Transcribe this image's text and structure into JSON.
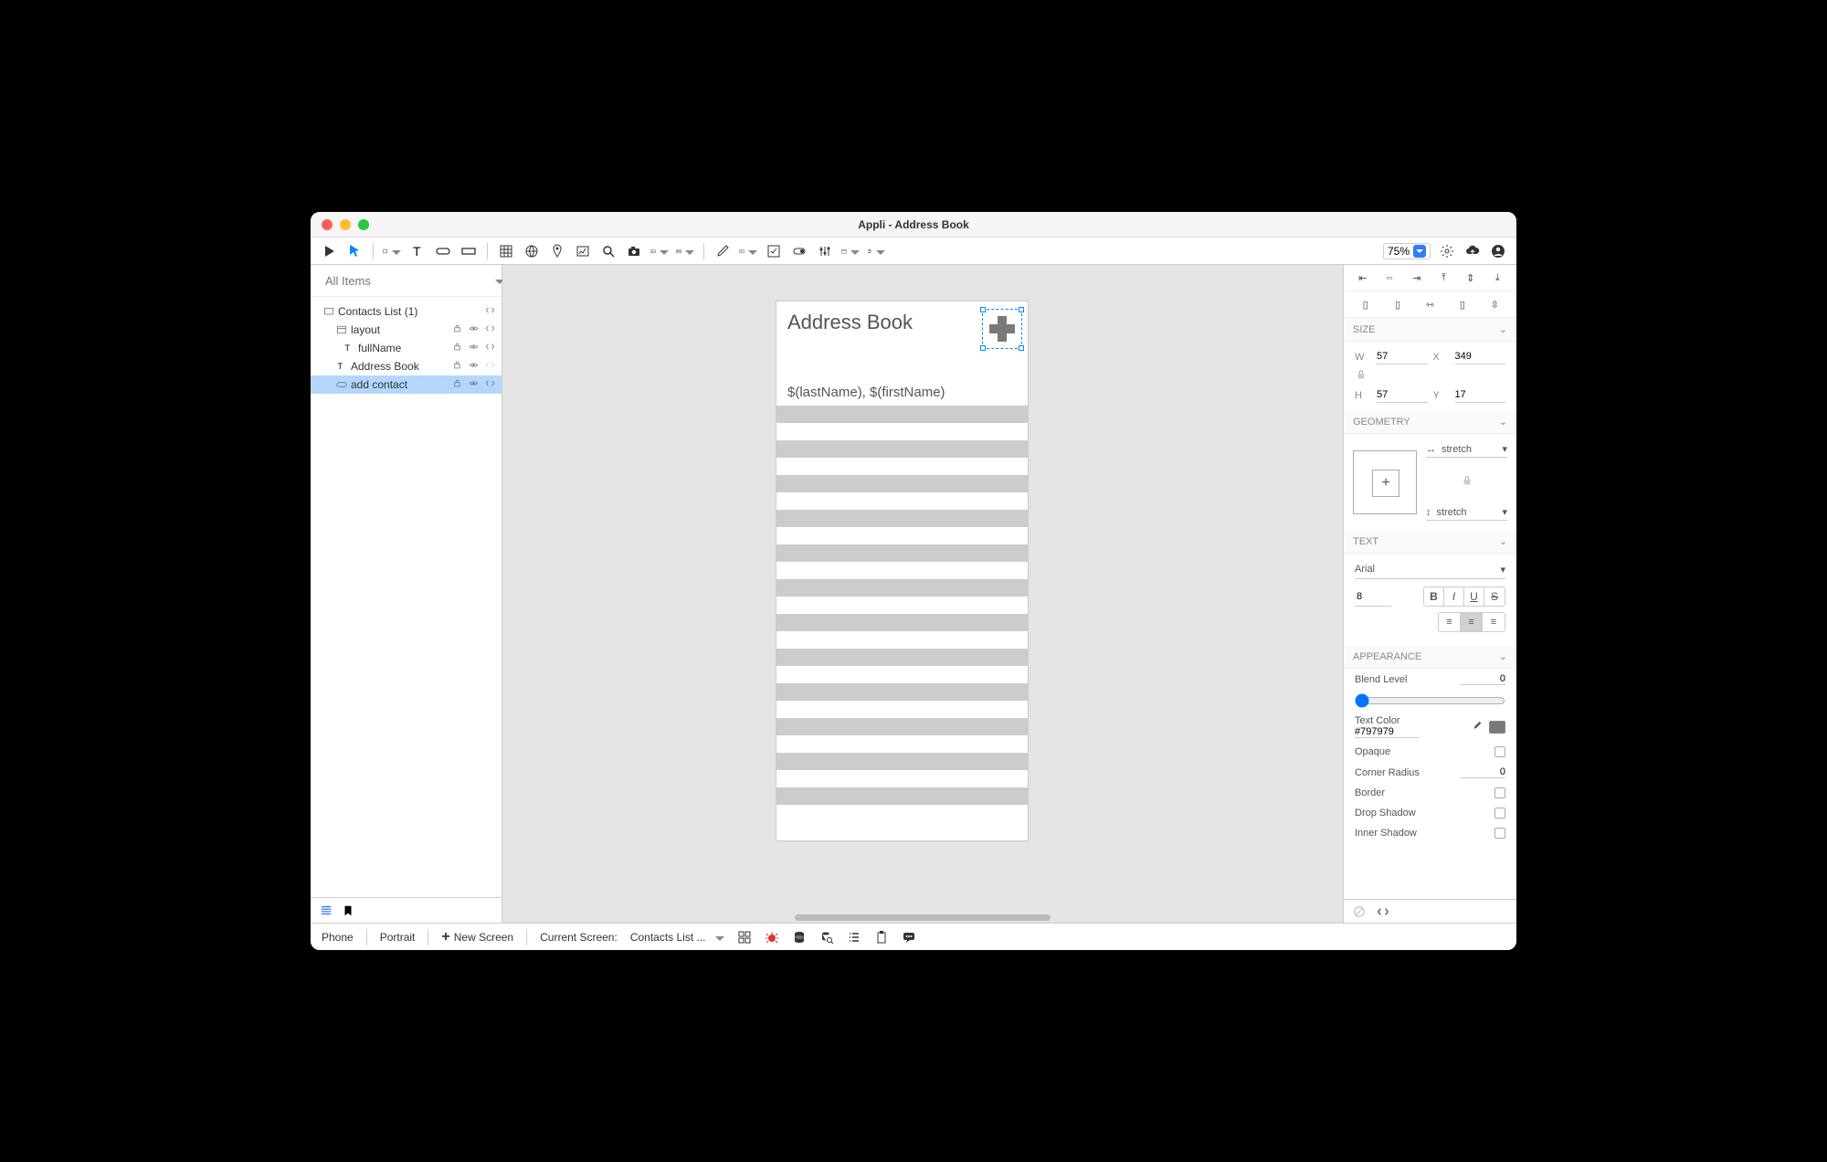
{
  "window": {
    "title": "Appli - Address Book"
  },
  "toolbar": {
    "zoom": "75%"
  },
  "leftPanel": {
    "searchPlaceholder": "All Items",
    "items": [
      {
        "label": "Contacts List (1)",
        "indent": 14,
        "icon": "screen",
        "right": [
          "code"
        ]
      },
      {
        "label": "layout",
        "indent": 28,
        "icon": "layout",
        "right": [
          "lock",
          "eye",
          "code"
        ]
      },
      {
        "label": "fullName",
        "indent": 36,
        "icon": "text",
        "right": [
          "lock",
          "eye",
          "code"
        ]
      },
      {
        "label": "Address Book",
        "indent": 28,
        "icon": "text",
        "right": [
          "lock",
          "eye",
          "code-dim"
        ]
      },
      {
        "label": "add contact",
        "indent": 28,
        "icon": "button",
        "right": [
          "lock",
          "eye",
          "code"
        ],
        "selected": true
      }
    ]
  },
  "canvas": {
    "screenTitle": "Address Book",
    "listRowTemplate": "$(lastName), $(firstName)"
  },
  "inspector": {
    "size": {
      "label": "SIZE",
      "W": "57",
      "X": "349",
      "H": "57",
      "Y": "17"
    },
    "geometry": {
      "label": "GEOMETRY",
      "h": "stretch",
      "v": "stretch"
    },
    "text": {
      "label": "TEXT",
      "font": "Arial",
      "size": "8"
    },
    "appearance": {
      "label": "APPEARANCE",
      "blendLevelLabel": "Blend Level",
      "blendLevel": "0",
      "textColorLabel": "Text Color",
      "textColor": "#797979",
      "opaqueLabel": "Opaque",
      "cornerRadiusLabel": "Corner Radius",
      "cornerRadius": "0",
      "borderLabel": "Border",
      "dropShadowLabel": "Drop Shadow",
      "innerShadowLabel": "Inner Shadow"
    }
  },
  "statusbar": {
    "device": "Phone",
    "orientation": "Portrait",
    "newScreen": "New Screen",
    "currentScreenLabel": "Current Screen:",
    "currentScreen": "Contacts List ..."
  }
}
